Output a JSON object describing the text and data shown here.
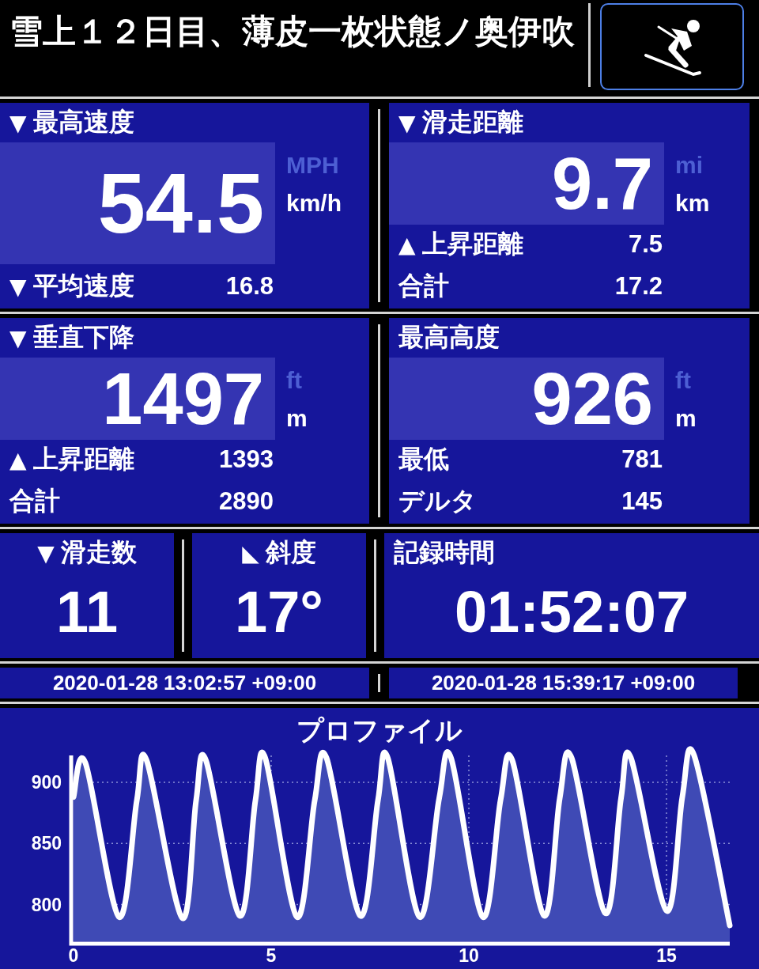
{
  "header": {
    "title": "雪上１２日目、薄皮一枚状態ノ奥伊吹"
  },
  "panels": [
    {
      "marker": "▼",
      "label": "最高速度",
      "value": "54.5",
      "units": [
        {
          "text": "MPH",
          "selected": false
        },
        {
          "text": "km/h",
          "selected": true
        }
      ],
      "rows": [
        {
          "marker": "▼",
          "label": "平均速度",
          "value": "16.8"
        }
      ]
    },
    {
      "marker": "▼",
      "label": "滑走距離",
      "value": "9.7",
      "units": [
        {
          "text": "mi",
          "selected": false
        },
        {
          "text": "km",
          "selected": true
        }
      ],
      "rows": [
        {
          "marker": "▲",
          "label": "上昇距離",
          "value": "7.5"
        },
        {
          "label": "合計",
          "value": "17.2"
        }
      ]
    },
    {
      "marker": "▼",
      "label": "垂直下降",
      "value": "1497",
      "units": [
        {
          "text": "ft",
          "selected": false
        },
        {
          "text": "m",
          "selected": true
        }
      ],
      "rows": [
        {
          "marker": "▲",
          "label": "上昇距離",
          "value": "1393"
        },
        {
          "label": "合計",
          "value": "2890"
        }
      ]
    },
    {
      "label": "最高高度",
      "value": "926",
      "units": [
        {
          "text": "ft",
          "selected": false
        },
        {
          "text": "m",
          "selected": true
        }
      ],
      "rows": [
        {
          "label": "最低",
          "value": "781"
        },
        {
          "label": "デルタ",
          "value": "145"
        }
      ]
    }
  ],
  "small_panels": [
    {
      "marker": "▼",
      "label": "滑走数",
      "value": "11"
    },
    {
      "marker": "◣",
      "label": "斜度",
      "value": "17°"
    },
    {
      "label": "記録時間",
      "value": "01:52:07"
    }
  ],
  "timestamps": [
    "2020-01-28 13:02:57 +09:00",
    "2020-01-28 15:39:17 +09:00"
  ],
  "profile": {
    "chart_data": {
      "type": "area",
      "title": "プロファイル",
      "x": [
        0,
        0.3,
        1.15,
        1.6,
        1.85,
        2.75,
        3.1,
        3.35,
        4.2,
        4.6,
        4.85,
        5.65,
        6.1,
        6.4,
        7.25,
        7.7,
        7.95,
        8.75,
        9.25,
        9.55,
        10.35,
        10.8,
        11.1,
        11.9,
        12.3,
        12.6,
        13.45,
        13.85,
        14.1,
        15.0,
        15.4,
        15.7,
        16.6
      ],
      "series": [
        {
          "color": "#ffffff",
          "values": [
            888,
            916,
            790,
            885,
            918,
            789,
            885,
            918,
            791,
            885,
            920,
            790,
            885,
            920,
            791,
            885,
            920,
            790,
            887,
            920,
            790,
            885,
            918,
            791,
            887,
            920,
            793,
            887,
            920,
            795,
            888,
            922,
            783
          ]
        }
      ],
      "xlim": [
        0,
        16.6
      ],
      "ylim": [
        770,
        922
      ],
      "grid": true,
      "xticks": [
        0,
        5,
        10,
        15
      ],
      "yticks": [
        800,
        850,
        900
      ]
    }
  }
}
